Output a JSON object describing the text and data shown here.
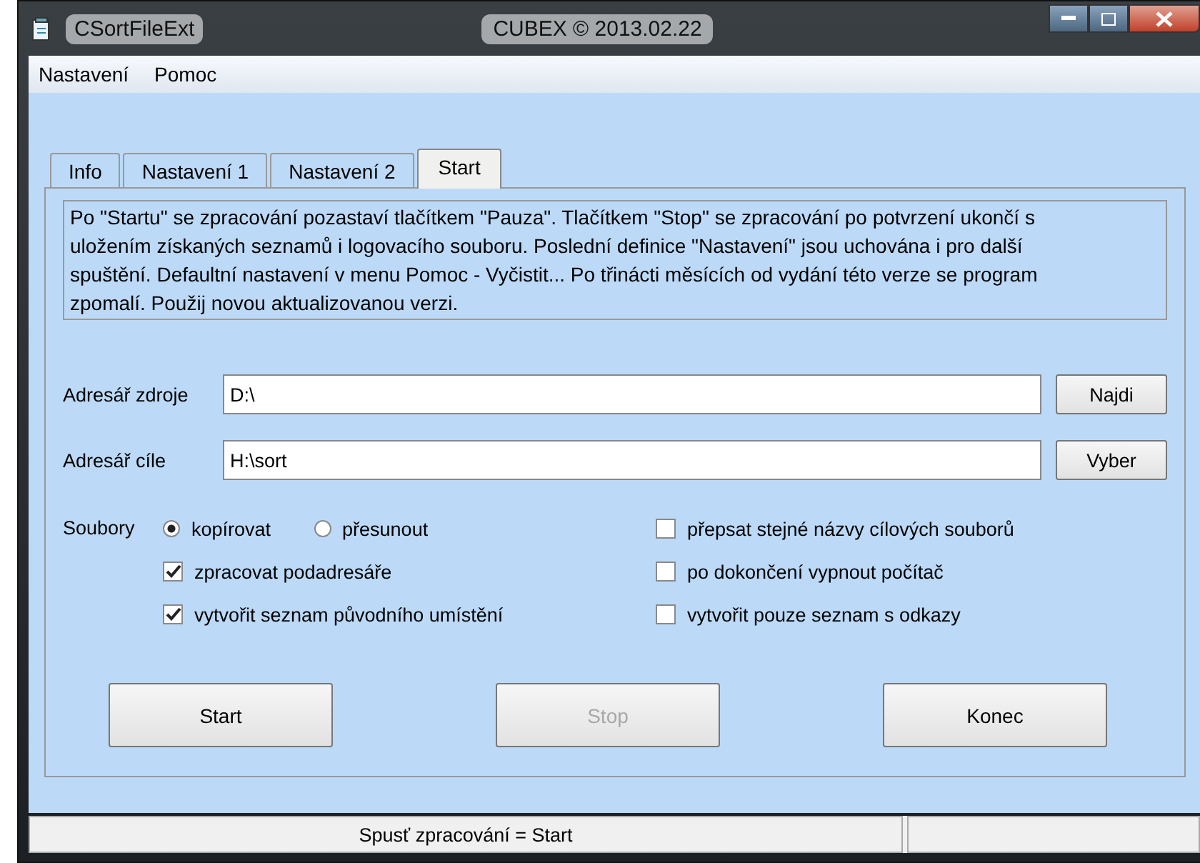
{
  "window": {
    "title": "CSortFileExt",
    "subtitle": "CUBEX  ©  2013.02.22"
  },
  "menu": [
    "Nastavení",
    "Pomoc"
  ],
  "tabs": [
    {
      "label": "Info",
      "selected": false
    },
    {
      "label": "Nastavení 1",
      "selected": false
    },
    {
      "label": "Nastavení 2",
      "selected": false
    },
    {
      "label": "Start",
      "selected": true
    }
  ],
  "info_text": "Po \"Startu\" se zpracování pozastaví tlačítkem \"Pauza\". Tlačítkem \"Stop\" se zpracování po potvrzení ukončí s uložením získaných seznamů i logovacího souboru. Poslední definice \"Nastavení\" jsou uchována i pro další spuštění. Defaultní nastavení v menu Pomoc - Vyčistit... Po třinácti měsících od vydání této verze se program zpomalí. Použij novou aktualizovanou verzi.",
  "fields": [
    {
      "label": "Adresář zdroje",
      "value": "D:\\",
      "button": "Najdi"
    },
    {
      "label": "Adresář cíle",
      "value": "H:\\sort",
      "button": "Vyber"
    }
  ],
  "files_label": "Soubory",
  "radios": [
    {
      "label": "kopírovat",
      "selected": true
    },
    {
      "label": "přesunout",
      "selected": false
    }
  ],
  "left_checks": [
    {
      "label": "zpracovat podadresáře",
      "checked": true
    },
    {
      "label": "vytvořit seznam původního umístění",
      "checked": true
    }
  ],
  "right_checks": [
    {
      "label": "přepsat stejné názvy cílových souborů",
      "checked": false
    },
    {
      "label": "po dokončení vypnout počítač",
      "checked": false
    },
    {
      "label": "vytvořit pouze seznam s odkazy",
      "checked": false
    }
  ],
  "buttons": [
    {
      "label": "Start",
      "disabled": false
    },
    {
      "label": "Stop",
      "disabled": true
    },
    {
      "label": "Konec",
      "disabled": false
    }
  ],
  "status_bar": {
    "text": "Spusť zpracování = Start"
  }
}
